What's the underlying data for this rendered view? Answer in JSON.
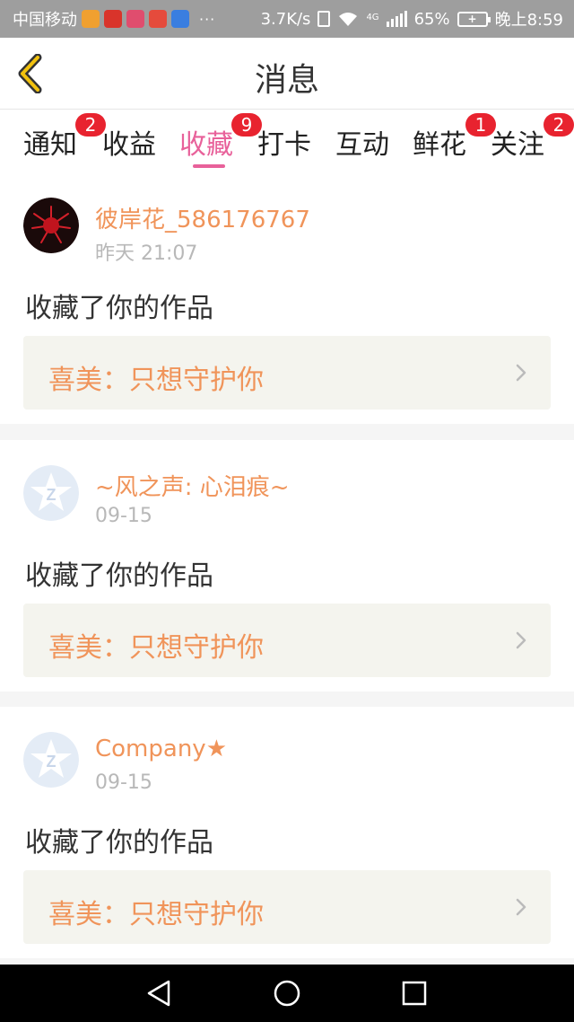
{
  "status_bar": {
    "carrier": "中国移动",
    "dots": "···",
    "speed": "3.7K/s",
    "network": "4G",
    "battery": "65%",
    "time": "晚上8:59",
    "icons": [
      "video-app-icon",
      "weibo-icon",
      "meitu-icon",
      "calendar-app-icon",
      "baidu-paw-icon",
      "vibrate-icon",
      "wifi-icon",
      "signal-icon",
      "battery-icon"
    ]
  },
  "header": {
    "title": "消息",
    "back_icon": "chevron-left-icon"
  },
  "tabs": [
    {
      "label": "通知",
      "badge": "2"
    },
    {
      "label": "收益",
      "badge": ""
    },
    {
      "label": "收藏",
      "badge": "9",
      "active": true
    },
    {
      "label": "打卡",
      "badge": ""
    },
    {
      "label": "互动",
      "badge": ""
    },
    {
      "label": "鲜花",
      "badge": "1"
    },
    {
      "label": "关注",
      "badge": "2"
    }
  ],
  "messages": [
    {
      "user": "彼岸花_586176767",
      "time": "昨天 21:07",
      "action": "收藏了你的作品",
      "work": "喜美：只想守护你",
      "avatar": "red-flower-avatar"
    },
    {
      "user": "~风之声: 心泪痕~",
      "time": "09-15",
      "action": "收藏了你的作品",
      "work": "喜美：只想守护你",
      "avatar": "default-avatar"
    },
    {
      "user": "Company★",
      "time": "09-15",
      "action": "收藏了你的作品",
      "work": "喜美：只想守护你",
      "avatar": "default-avatar"
    }
  ],
  "colors": {
    "accent": "#e8619a",
    "username": "#f0945a",
    "badge": "#e8232f",
    "work_bg": "#f4f4ee"
  },
  "nav_bar": {
    "icons": [
      "back-triangle-icon",
      "home-circle-icon",
      "recents-square-icon"
    ]
  }
}
